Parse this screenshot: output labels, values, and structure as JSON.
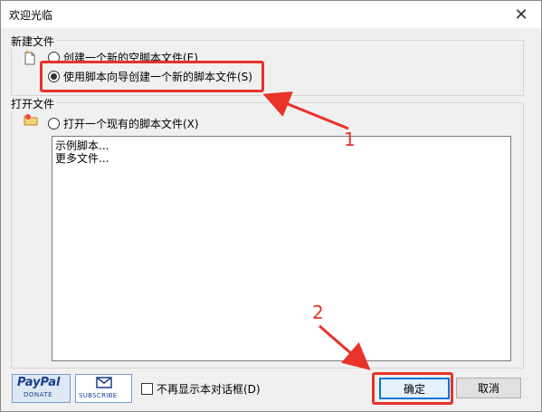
{
  "window": {
    "title": "欢迎光临"
  },
  "new_group": {
    "label": "新建文件",
    "option_empty": "创建一个新的空脚本文件(E)",
    "option_wizard": "使用脚本向导创建一个新的脚本文件(S)"
  },
  "open_group": {
    "label": "打开文件",
    "option_open": "打开一个现有的脚本文件(X)",
    "list_items": [
      "示例脚本...",
      "更多文件..."
    ]
  },
  "footer": {
    "paypal_brand": "PayPal",
    "paypal_caption": "DONATE",
    "subscribe_caption": "SUBSCRIBE",
    "dont_show_label": "不再显示本对话框(D)",
    "ok_label": "确定",
    "cancel_label": "取消"
  },
  "annotations": {
    "step1": "1",
    "step2": "2"
  },
  "colors": {
    "annotation": "#e8322a",
    "accent": "#0078d7"
  }
}
